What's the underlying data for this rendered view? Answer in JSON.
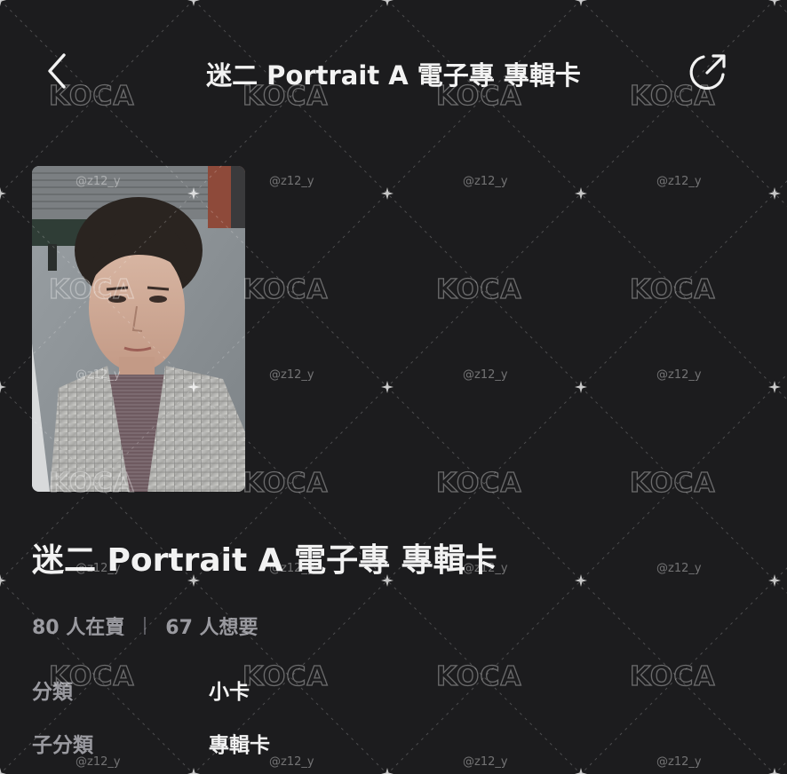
{
  "header": {
    "title": "迷二 Portrait A 電子專 專輯卡",
    "back_icon": "chevron-left-icon",
    "share_icon": "share-icon"
  },
  "item": {
    "title": "迷二 Portrait A 電子專 專輯卡",
    "photo_alt": "photocard-image"
  },
  "stats": {
    "selling": "80 人在賣",
    "wanting": "67 人想要"
  },
  "attributes": [
    {
      "label": "分類",
      "value": "小卡"
    },
    {
      "label": "子分類",
      "value": "專輯卡"
    }
  ],
  "watermark": {
    "logo_text": "KOCA",
    "handle": "@z12_y"
  },
  "colors": {
    "background": "#1c1c1e",
    "primary_text": "#f2f2f2",
    "secondary_text": "#9a9aa0"
  }
}
